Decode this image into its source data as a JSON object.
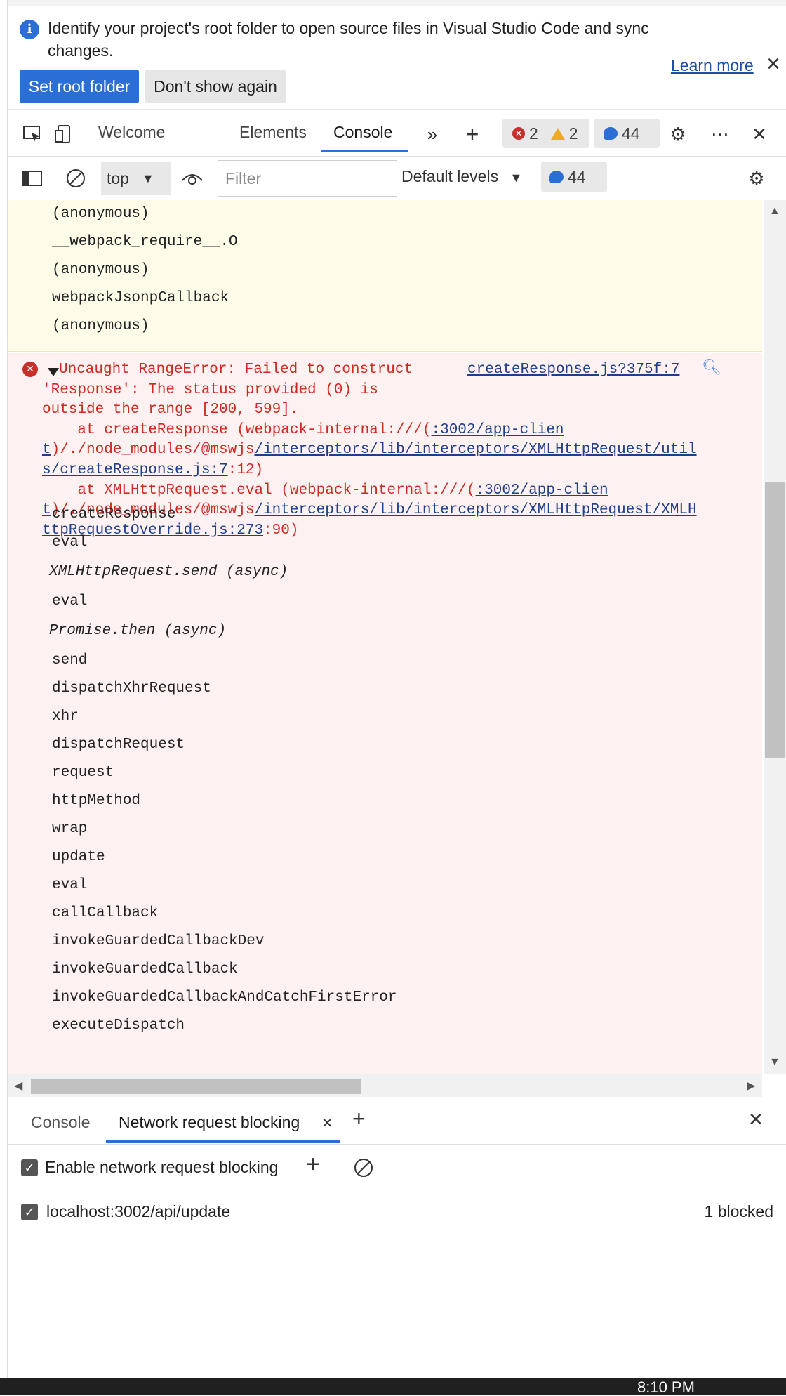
{
  "banner": {
    "message": "Identify your project's root folder to open source files in Visual Studio Code and sync changes.",
    "set_root_label": "Set root folder",
    "dont_show_label": "Don't show again",
    "learn_more_label": "Learn more"
  },
  "tabs": {
    "welcome": "Welcome",
    "elements": "Elements",
    "console": "Console",
    "errors_count": "2",
    "warnings_count": "2",
    "messages_count": "44"
  },
  "console_toolbar": {
    "context": "top",
    "filter_placeholder": "Filter",
    "levels_label": "Default levels",
    "messages_count": "44"
  },
  "warning_stack": [
    "(anonymous)",
    "__webpack_require__.O",
    "(anonymous)",
    "webpackJsonpCallback",
    "(anonymous)"
  ],
  "error": {
    "line1": "Uncaught RangeError: Failed to construct",
    "line2": "'Response': The status provided (0) is",
    "line3": "outside the range [200, 599].",
    "line4_pre": "    at createResponse (webpack-internal:///(",
    "line4_link": ":3002/app-clien",
    "line5_link_a": "t",
    "line5_mid": ")/./node_modules/@mswjs",
    "line5_link_b": "/interceptors/lib/interceptors/XMLHttpRequest/util",
    "line6_link": "s/createResponse.js:7",
    "line6_post": ":12)",
    "line7_pre": "    at XMLHttpRequest.eval (webpack-internal:///(",
    "line7_link": ":3002/app-clien",
    "line8_link_a": "t",
    "line8_mid": ")/./node_modules/@mswjs",
    "line8_link_b": "/interceptors/lib/interceptors/XMLHttpRequest/XMLH",
    "line9_link": "ttpRequestOverride.js:273",
    "line9_post": ":90)",
    "source": "createResponse.js?375f:7"
  },
  "error_stack": [
    "createResponse",
    "eval",
    "XMLHttpRequest.send (async)",
    "eval",
    "Promise.then (async)",
    "send",
    "dispatchXhrRequest",
    "xhr",
    "dispatchRequest",
    "request",
    "httpMethod",
    "wrap",
    "update",
    "eval",
    "callCallback",
    "invokeGuardedCallbackDev",
    "invokeGuardedCallback",
    "invokeGuardedCallbackAndCatchFirstError",
    "executeDispatch"
  ],
  "drawer": {
    "tab_console": "Console",
    "tab_nrb": "Network request blocking",
    "enable_label": "Enable network request blocking",
    "pattern": "localhost:3002/api/update",
    "blocked": "1 blocked"
  },
  "taskbar": {
    "time": "8:10 PM"
  },
  "colors": {
    "accent": "#2b6fd6",
    "error": "#cf2a22",
    "error_bg": "#fdf1f1",
    "warning_bg": "#fefce8"
  }
}
